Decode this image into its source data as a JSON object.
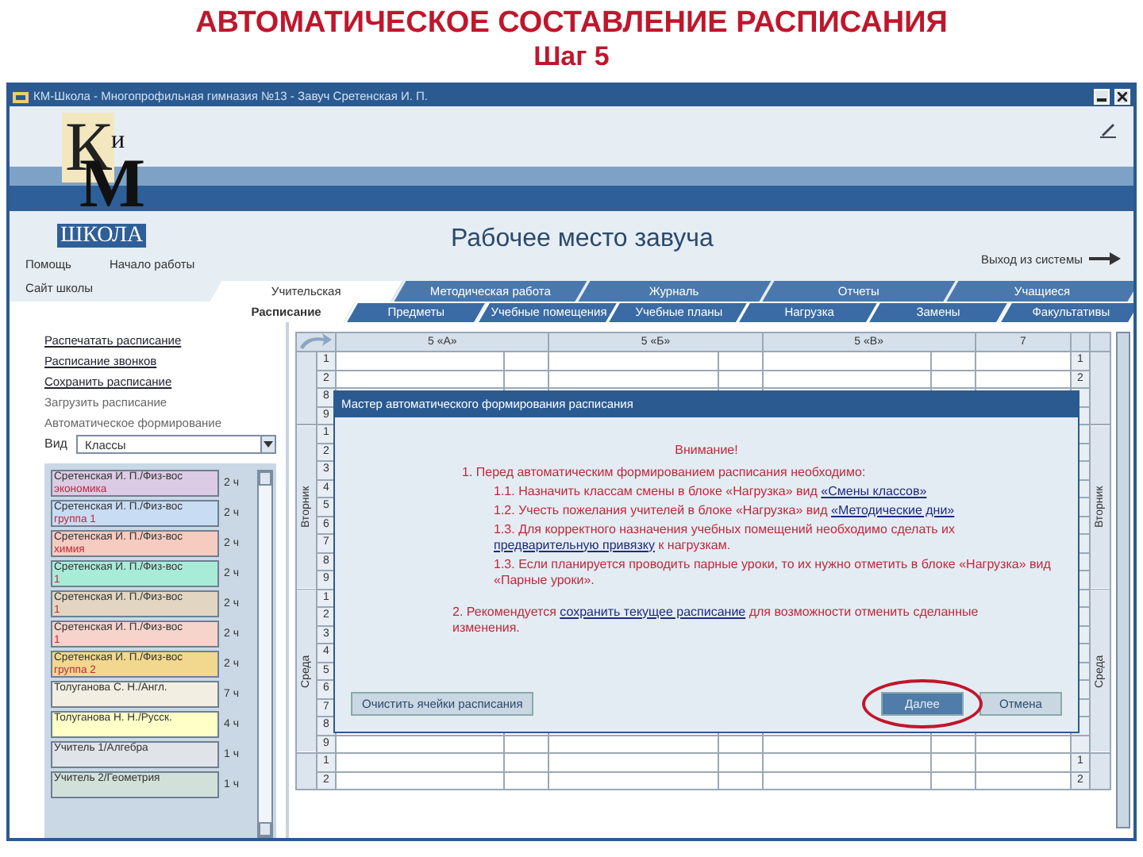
{
  "slide": {
    "title": "АВТОМАТИЧЕСКОЕ СОСТАВЛЕНИЕ РАСПИСАНИЯ",
    "subtitle": "Шаг 5"
  },
  "window": {
    "title": "КМ-Школа - Многопрофильная гимназия №13 - Завуч Сретенская И. П."
  },
  "logo": {
    "letters": [
      "К",
      "и",
      "М"
    ],
    "caption": "ШКОЛА"
  },
  "header": {
    "title": "Рабочее место завуча",
    "exit": "Выход из системы"
  },
  "top_links": [
    "Помощь",
    "Начало работы",
    "Сайт школы"
  ],
  "tabs": [
    {
      "label": "Учительская",
      "selected": true
    },
    {
      "label": "Методическая работа",
      "selected": false
    },
    {
      "label": "Журналь",
      "selected": false
    },
    {
      "label": "Отчеты",
      "selected": false
    },
    {
      "label": "Учащиеся",
      "selected": false
    }
  ],
  "subtabs": [
    {
      "label": "Расписание",
      "selected": true
    },
    {
      "label": "Предметы",
      "selected": false
    },
    {
      "label": "Учебные помещения",
      "selected": false
    },
    {
      "label": "Учебные планы",
      "selected": false
    },
    {
      "label": "Нагрузка",
      "selected": false
    },
    {
      "label": "Замены",
      "selected": false
    },
    {
      "label": "Факультативы",
      "selected": false
    }
  ],
  "sidebar": {
    "actions": [
      {
        "label": "Распечатать расписание",
        "disabled": false
      },
      {
        "label": "Расписание звонков",
        "disabled": false
      },
      {
        "label": "Сохранить расписание",
        "disabled": false
      },
      {
        "label": "Загрузить расписание",
        "disabled": true
      },
      {
        "label": "Автоматическое формирование",
        "disabled": true
      }
    ],
    "view": {
      "label": "Вид",
      "value": "Классы"
    }
  },
  "lessons": [
    {
      "teacher": "Сретенская И. П./Физ-вос",
      "group": "экономика",
      "hours": "2 ч",
      "color": "#dccbe4"
    },
    {
      "teacher": "Сретенская И. П./Физ-вос",
      "group": "группа 1",
      "hours": "2 ч",
      "color": "#c8dcf4"
    },
    {
      "teacher": "Сретенская И. П./Физ-вос",
      "group": "химия",
      "hours": "2 ч",
      "color": "#f6cbc0"
    },
    {
      "teacher": "Сретенская И. П./Физ-вос",
      "group": "1",
      "hours": "2 ч",
      "color": "#a8ecd8"
    },
    {
      "teacher": "Сретенская И. П./Физ-вос",
      "group": "1",
      "hours": "2 ч",
      "color": "#e2d6c2"
    },
    {
      "teacher": "Сретенская И. П./Физ-вос",
      "group": "1",
      "hours": "2 ч",
      "color": "#f6d4cc"
    },
    {
      "teacher": "Сретенская И. П./Физ-вос",
      "group": "группа 2",
      "hours": "2 ч",
      "color": "#f2d88e"
    },
    {
      "teacher": "Толуганова С. Н./Англ.",
      "hours": "7 ч",
      "color": "#f2eee2"
    },
    {
      "teacher": "Толуганова Н. Н./Русск.",
      "hours": "4 ч",
      "color": "#ffffc8"
    },
    {
      "teacher": "Учитель 1/Алгебра",
      "hours": "1 ч",
      "color": "#e0e4e8"
    },
    {
      "teacher": "Учитель 2/Геометрия",
      "hours": "1 ч",
      "color": "#d2e0da"
    }
  ],
  "grid": {
    "columns": [
      "5 «А»",
      "5 «Б»",
      "5 «В»",
      "7"
    ],
    "groups": [
      {
        "rows": [
          "1",
          "2",
          "8",
          "9"
        ],
        "side_rows": [
          "1",
          "2"
        ]
      },
      {
        "day": "Вторник",
        "side_day": "Вторник",
        "rows": [
          "1",
          "2",
          "3",
          "4",
          "5",
          "6",
          "7",
          "8",
          "9"
        ]
      },
      {
        "day": "Среда",
        "side_day": "Среда",
        "rows": [
          "1",
          "2",
          "3",
          "4",
          "5",
          "6",
          "7",
          "8",
          "9"
        ]
      },
      {
        "rows": [
          "1",
          "2"
        ],
        "side_rows": [
          "1",
          "2"
        ]
      }
    ]
  },
  "dialog": {
    "title": "Мастер автоматического формирования расписания",
    "heading": "Внимание!",
    "intro": "1. Перед автоматическим формированием расписания необходимо:",
    "steps": [
      [
        {
          "text": "1.1. Назначить классам смены в блоке «Нагрузка» вид "
        },
        {
          "link": "«Смены классов»"
        }
      ],
      [
        {
          "text": "1.2. Учесть пожелания учителей в блоке «Нагрузка» вид "
        },
        {
          "link": "«Методические дни»"
        }
      ],
      [
        {
          "text": "1.3. Для корректного назначения учебных помещений необходимо сделать их "
        },
        {
          "link": "предварительную привязку"
        },
        {
          "text": " к нагрузкам."
        }
      ],
      [
        {
          "text": "1.3. Если планируется проводить парные уроки, то их нужно отметить в блоке «Нагрузка» вид «Парные уроки»."
        }
      ]
    ],
    "note": [
      {
        "text": "2. Рекомендуется "
      },
      {
        "link": "сохранить текущее расписание"
      },
      {
        "text": " для возможности отменить сделанные изменения."
      }
    ],
    "buttons": [
      {
        "label": "Очистить ячейки расписания",
        "kind": "left",
        "highlighted": false
      },
      {
        "label": "Далее",
        "kind": "primary",
        "highlighted": true
      },
      {
        "label": "Отмена",
        "kind": "secondary",
        "highlighted": false
      }
    ]
  }
}
